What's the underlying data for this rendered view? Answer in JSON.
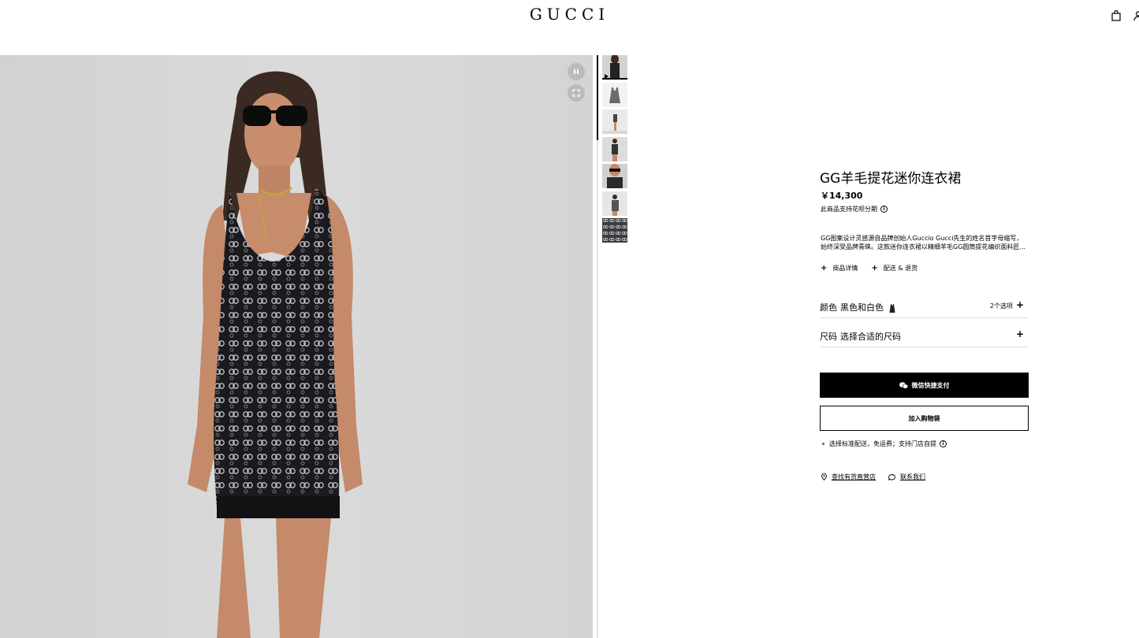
{
  "header": {
    "logo": "GUCCI",
    "icons": [
      "shopping-bag-icon",
      "account-icon"
    ]
  },
  "media": {
    "controls": [
      "pause-icon",
      "fullscreen-icon"
    ],
    "thumbnails": [
      "front-view",
      "product-flat",
      "full-look",
      "full-look-front",
      "sunglasses-closeup",
      "side-view",
      "gg-pattern-detail"
    ],
    "active_thumbnail": 1
  },
  "product": {
    "title": "GG羊毛提花迷你连衣裙",
    "price": "￥14,300",
    "installment": "此商品支持花呗分期",
    "description_line1": "GG图案设计灵感源自品牌创始人Guccio Gucci先生的姓名首字母缩写，",
    "description_line2": "始终深受品牌青睐。这款迷你连衣裙以精细羊毛GG圆筒提花编织面料匠...",
    "details_label": "商品详情",
    "shipping_returns_label": "配送 & 退货"
  },
  "options": {
    "color_label": "颜色",
    "color_value": "黑色和白色",
    "color_count": "2个选项",
    "size_label": "尺码",
    "size_value": "选择合适的尺码"
  },
  "actions": {
    "wechat_pay": "微信快捷支付",
    "add_to_bag": "加入购物袋"
  },
  "shipping_note": "选择标准配送，免运费；支持门店自提",
  "footer": {
    "find_store": "查找有货直营店",
    "contact_us": "联系我们"
  },
  "colors": {
    "image_bg": "#d6d6d6",
    "button_primary": "#000000",
    "availability_dot": "#2e8b3b"
  }
}
